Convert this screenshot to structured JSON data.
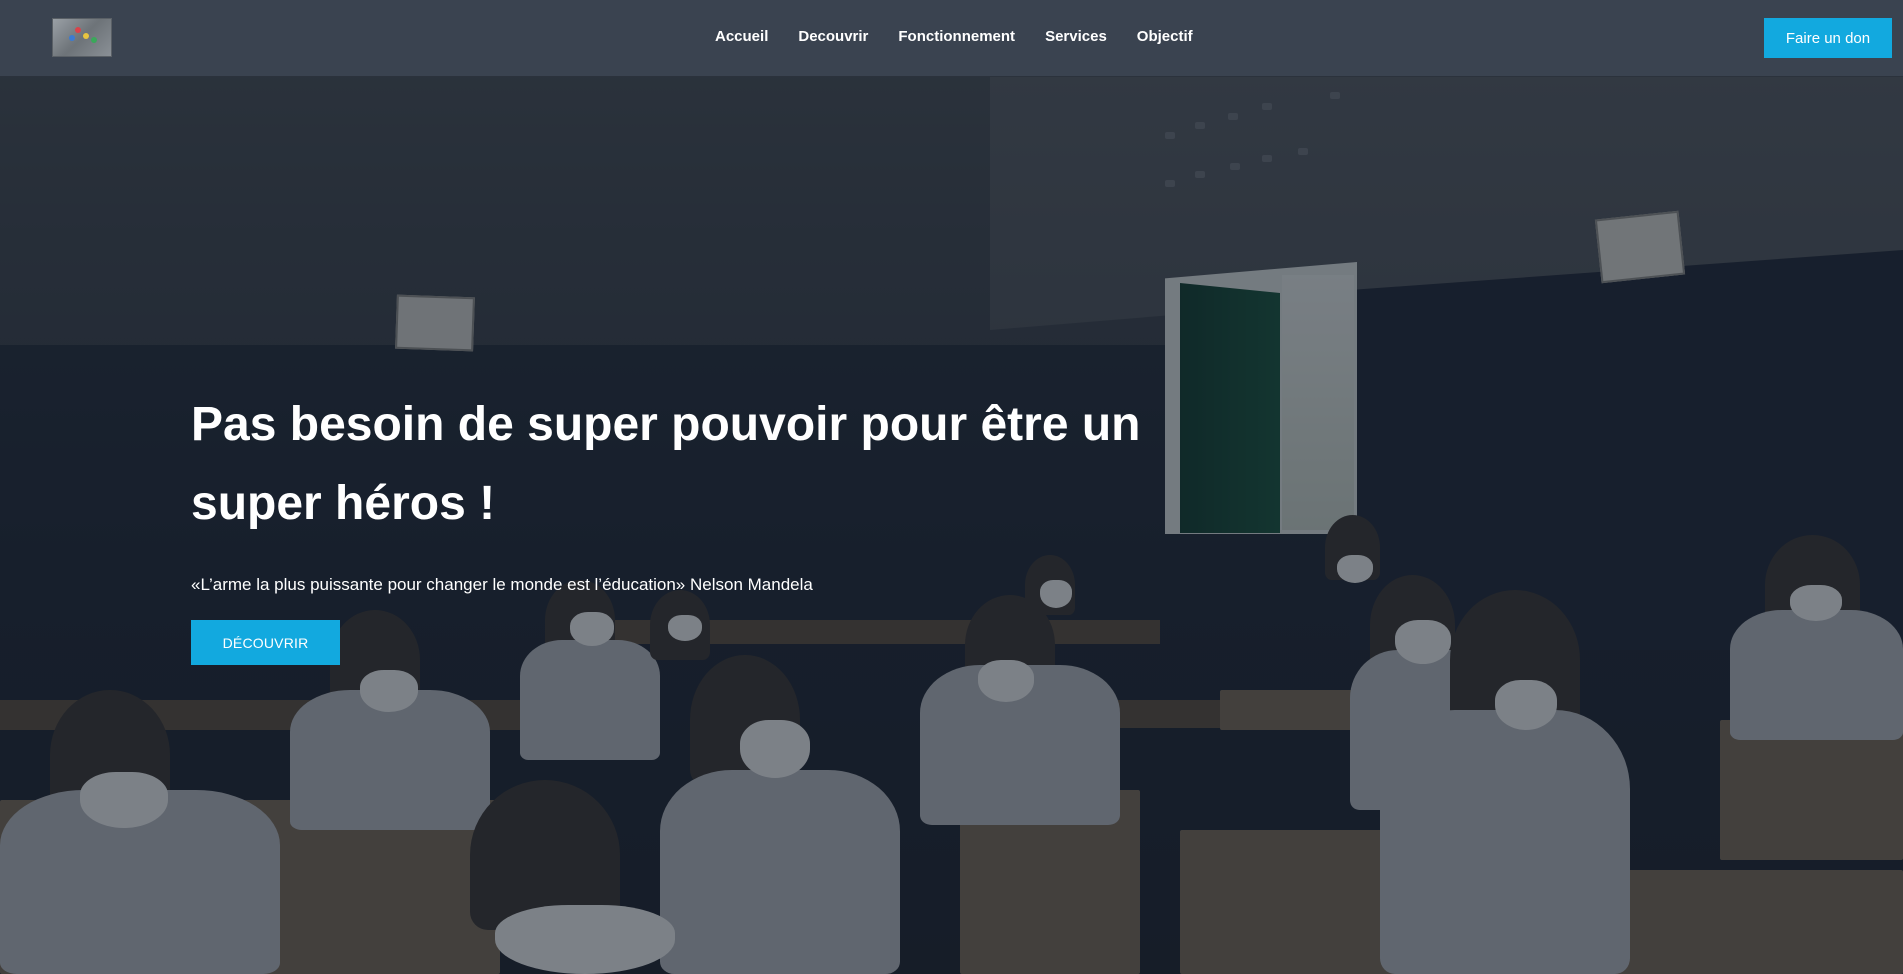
{
  "navbar": {
    "logo_icon": "organisation-logo",
    "links": [
      "Accueil",
      "Decouvrir",
      "Fonctionnement",
      "Services",
      "Objectif"
    ],
    "donate_label": "Faire un don"
  },
  "hero": {
    "title": "Pas besoin de super pouvoir pour être un super héros !",
    "quote": "«L’arme la plus puissante pour changer le monde est l’éducation» Nelson Mandela",
    "button_label": "DÉCOUVRIR",
    "background": "classroom-photo"
  },
  "colors": {
    "accent": "#12a9df",
    "navbar_bg": "#3a4350",
    "text": "#ffffff"
  }
}
